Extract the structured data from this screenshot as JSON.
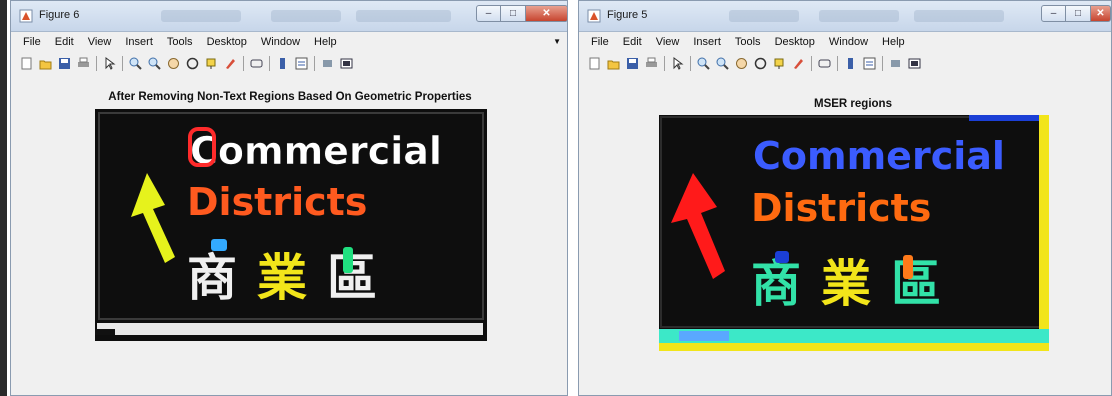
{
  "left_window": {
    "title": "Figure 6",
    "menu": [
      "File",
      "Edit",
      "View",
      "Insert",
      "Tools",
      "Desktop",
      "Window",
      "Help"
    ],
    "figure_title": "After Removing Non-Text Regions Based On Geometric Properties",
    "sign": {
      "line1": "Commercial",
      "line2": "Districts",
      "line3": [
        "商",
        "業",
        "區"
      ]
    }
  },
  "right_window": {
    "title": "Figure 5",
    "menu": [
      "File",
      "Edit",
      "View",
      "Insert",
      "Tools",
      "Desktop",
      "Window",
      "Help"
    ],
    "figure_title": "MSER regions",
    "sign": {
      "line1": "Commercial",
      "line2": "Districts",
      "line3": [
        "商",
        "業",
        "區"
      ]
    }
  },
  "window_controls": {
    "minimize": "–",
    "maximize": "□",
    "close": "✕"
  },
  "toolbar_icons": [
    "new-figure-icon",
    "open-file-icon",
    "save-icon",
    "print-icon",
    "pointer-icon",
    "zoom-in-icon",
    "zoom-out-icon",
    "pan-icon",
    "rotate-3d-icon",
    "data-cursor-icon",
    "brush-icon",
    "link-icon",
    "colorbar-icon",
    "legend-icon",
    "hide-plot-tools-icon",
    "show-plot-tools-icon"
  ],
  "annotation_arrow": "⟵",
  "colors": {
    "title_bar": "#c7d6ea",
    "window_bg": "#f0f0f0",
    "axes_bg": "#111111",
    "close_button": "#c7452f",
    "annotation_arrow": "#3a6fd0"
  }
}
